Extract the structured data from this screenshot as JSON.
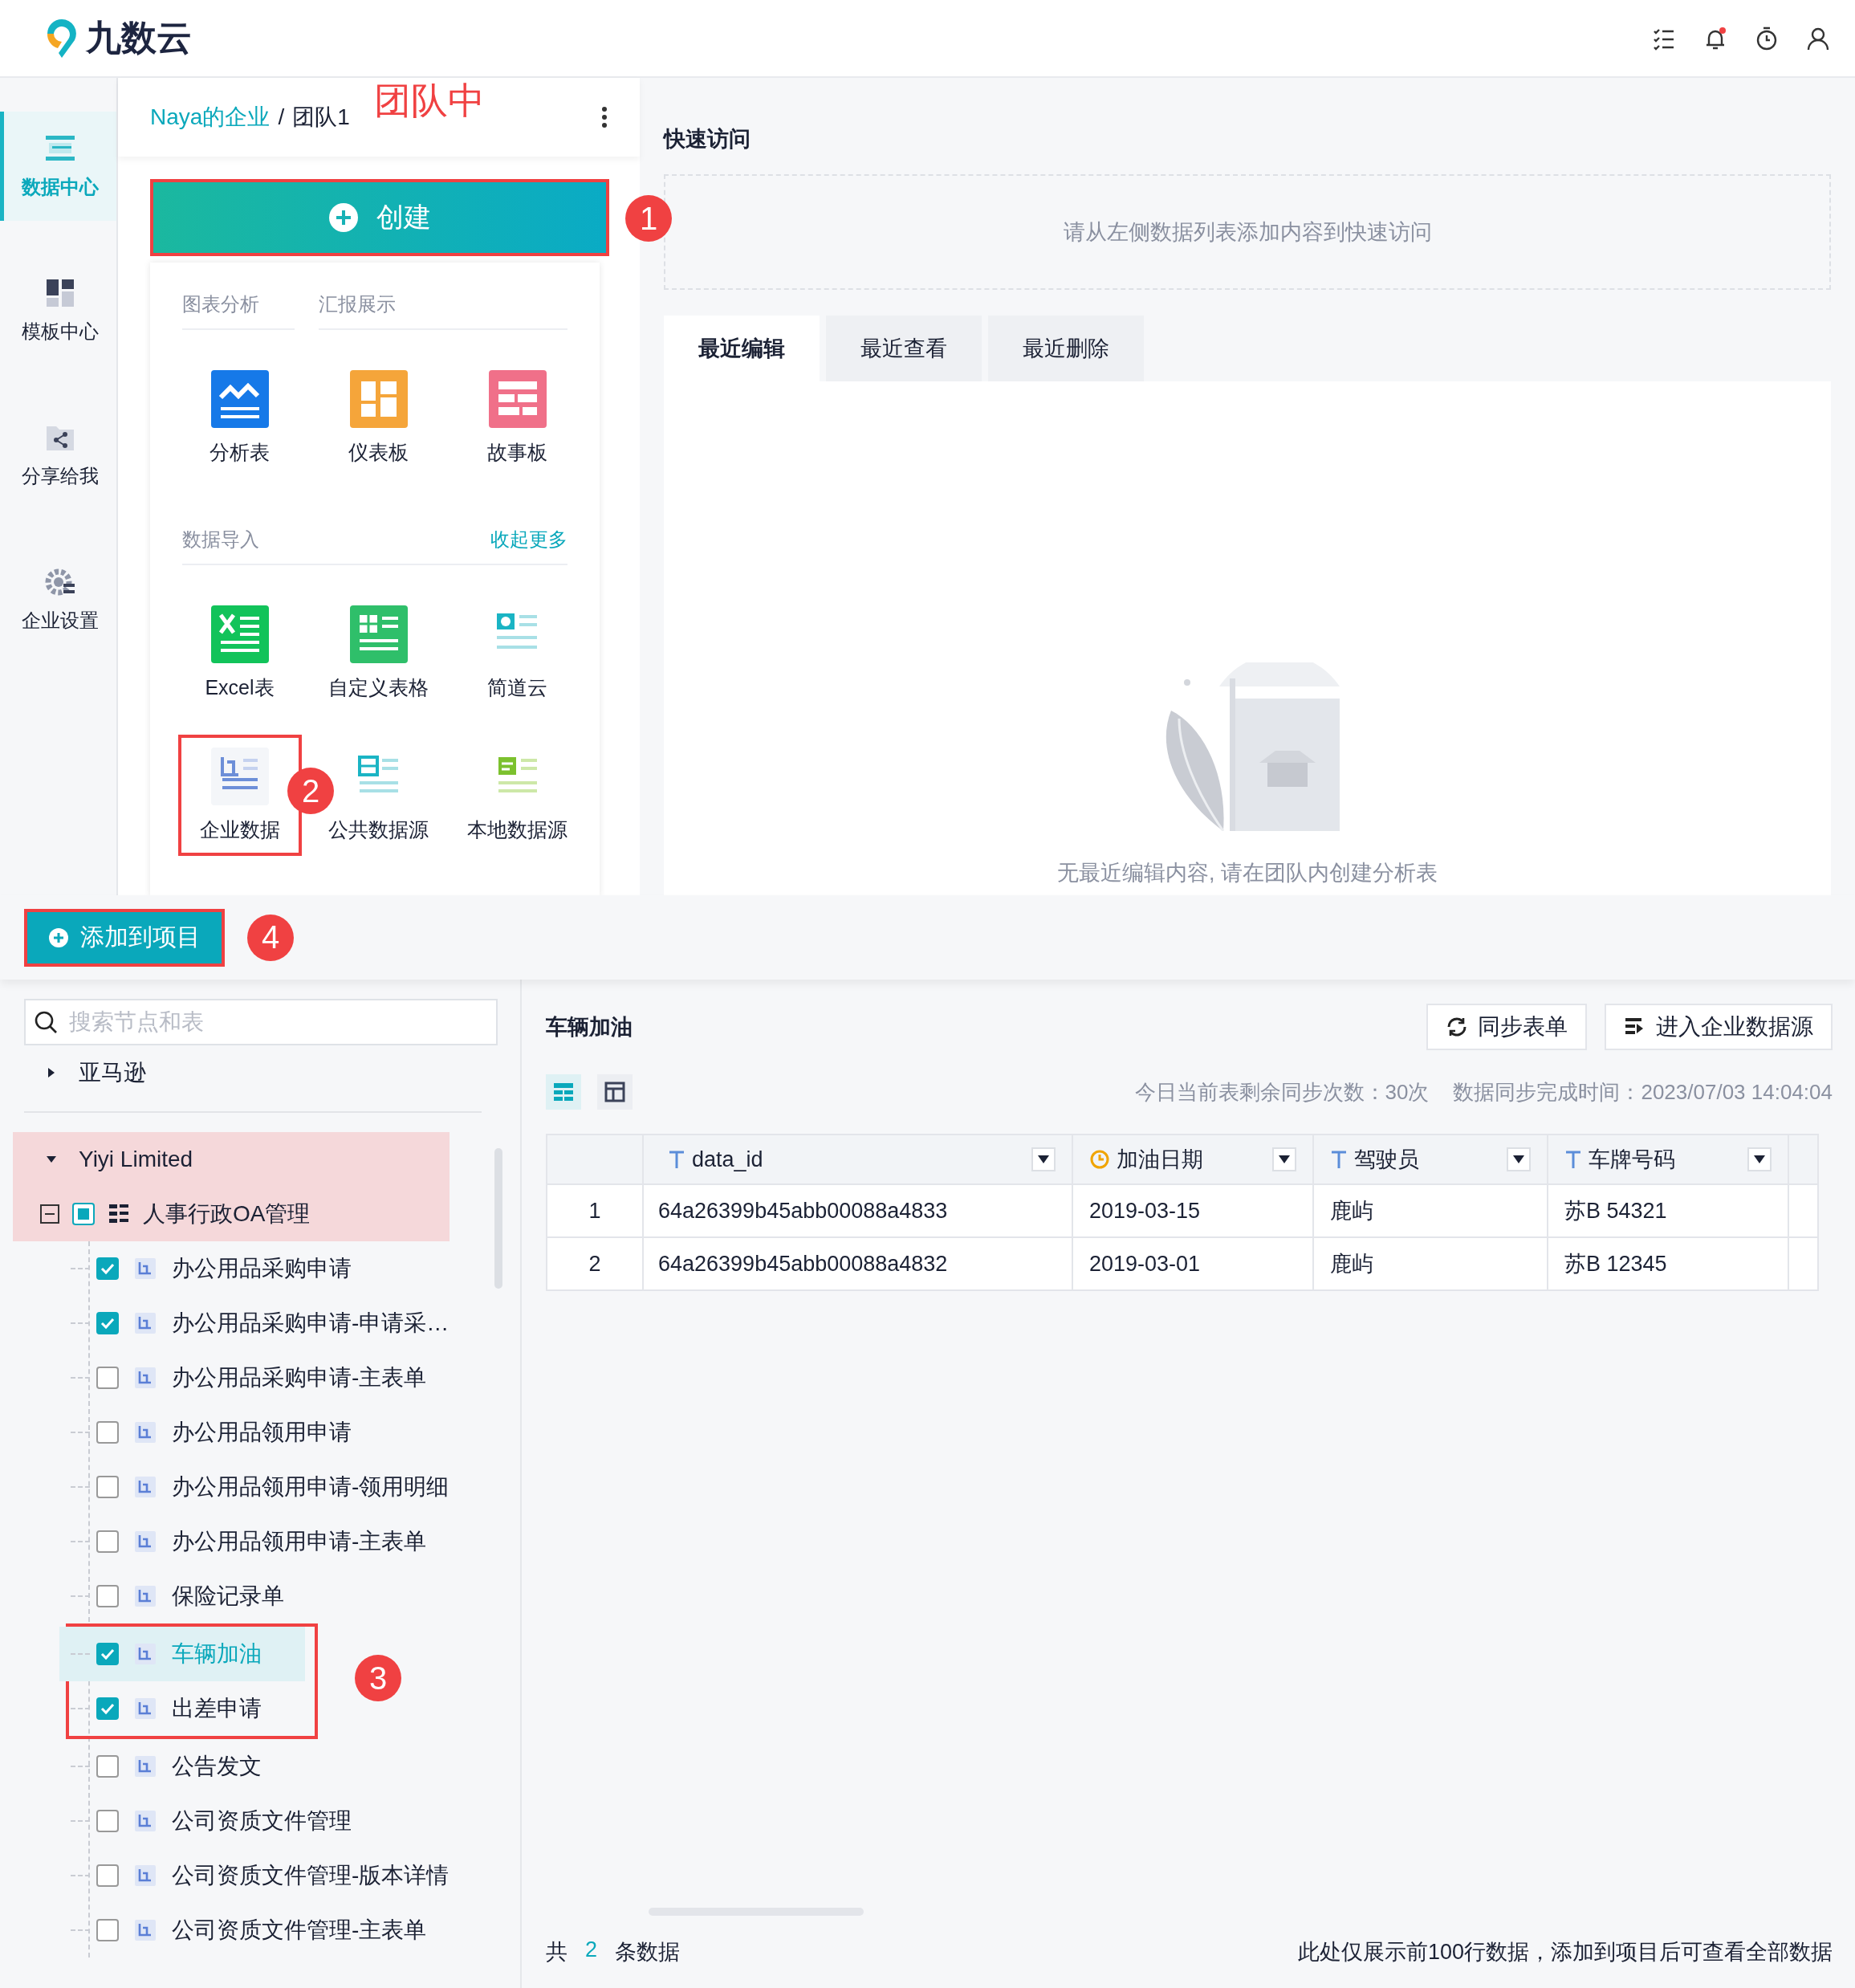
{
  "header": {
    "logo": "九数云",
    "notification_dot": true
  },
  "sidebar": {
    "items": [
      {
        "label": "数据中心",
        "kind": "data",
        "selected": true
      },
      {
        "label": "模板中心",
        "kind": "template",
        "selected": false
      },
      {
        "label": "分享给我",
        "kind": "share",
        "selected": false
      },
      {
        "label": "企业设置",
        "kind": "settings",
        "selected": false
      }
    ]
  },
  "team_panel": {
    "breadcrumb": {
      "link": "Naya的企业",
      "separator": "/",
      "current": "团队1"
    },
    "annotation": "团队中",
    "create_button": {
      "label": "创建",
      "callout": "1"
    },
    "menu": {
      "chart_tabs": [
        "图表分析",
        "汇报展示"
      ],
      "chart_items": [
        {
          "label": "分析表",
          "kind": "analysis"
        },
        {
          "label": "仪表板",
          "kind": "dashboard"
        },
        {
          "label": "故事板",
          "kind": "story"
        }
      ],
      "import_title": "数据导入",
      "import_action": "收起更多",
      "import_items": [
        {
          "label": "Excel表",
          "kind": "excel"
        },
        {
          "label": "自定义表格",
          "kind": "custom"
        },
        {
          "label": "简道云",
          "kind": "cloud"
        },
        {
          "label": "企业数据",
          "kind": "enterprise",
          "callout": "2"
        },
        {
          "label": "公共数据源",
          "kind": "public"
        },
        {
          "label": "本地数据源",
          "kind": "local"
        }
      ]
    }
  },
  "quick_access": {
    "title": "快速访问",
    "empty_text": "请从左侧数据列表添加内容到快速访问"
  },
  "recent_tabs": [
    {
      "label": "最近编辑",
      "selected": true
    },
    {
      "label": "最近查看",
      "selected": false
    },
    {
      "label": "最近删除",
      "selected": false
    }
  ],
  "recent_empty": "无最近编辑内容, 请在团队内创建分析表",
  "add_bar": {
    "label": "添加到项目",
    "callout": "4"
  },
  "tree": {
    "search_placeholder": "搜索节点和表",
    "callout_marker": "3",
    "nodes": [
      {
        "label": "亚马逊",
        "expanded": false,
        "highlighted": false
      },
      {
        "label": "Yiyi Limited",
        "expanded": true,
        "highlighted": true,
        "children": [
          {
            "label": "人事行政OA管理",
            "expanded": true,
            "checked": false,
            "indeterminate": true,
            "highlighted": true,
            "children": [
              {
                "label": "办公用品采购申请",
                "checked": true,
                "selected": false,
                "callout": false
              },
              {
                "label": "办公用品采购申请-申请采…",
                "checked": true,
                "selected": false,
                "callout": false
              },
              {
                "label": "办公用品采购申请-主表单",
                "checked": false,
                "selected": false,
                "callout": false
              },
              {
                "label": "办公用品领用申请",
                "checked": false,
                "selected": false,
                "callout": false
              },
              {
                "label": "办公用品领用申请-领用明细",
                "checked": false,
                "selected": false,
                "callout": false
              },
              {
                "label": "办公用品领用申请-主表单",
                "checked": false,
                "selected": false,
                "callout": false
              },
              {
                "label": "保险记录单",
                "checked": false,
                "selected": false,
                "callout": false
              },
              {
                "label": "车辆加油",
                "checked": true,
                "selected": true,
                "callout": true
              },
              {
                "label": "出差申请",
                "checked": true,
                "selected": false,
                "callout": true
              },
              {
                "label": "公告发文",
                "checked": false,
                "selected": false,
                "callout": false
              },
              {
                "label": "公司资质文件管理",
                "checked": false,
                "selected": false,
                "callout": false
              },
              {
                "label": "公司资质文件管理-版本详情",
                "checked": false,
                "selected": false,
                "callout": false
              },
              {
                "label": "公司资质文件管理-主表单",
                "checked": false,
                "selected": false,
                "callout": false
              }
            ]
          }
        ]
      }
    ]
  },
  "detail": {
    "title": "车辆加油",
    "buttons": [
      {
        "label": "同步表单",
        "kind": "sync"
      },
      {
        "label": "进入企业数据源",
        "kind": "enter"
      }
    ],
    "view_toggles": [
      {
        "kind": "rows",
        "selected": true
      },
      {
        "kind": "grid",
        "selected": false
      }
    ],
    "sync_count": "今日当前表剩余同步次数：30次",
    "sync_time": "数据同步完成时间：2023/07/03 14:04:04",
    "columns": [
      {
        "label": "data_id",
        "kind": "text"
      },
      {
        "label": "加油日期",
        "kind": "date"
      },
      {
        "label": "驾驶员",
        "kind": "text"
      },
      {
        "label": "车牌号码",
        "kind": "text"
      }
    ],
    "rows": [
      {
        "index": "1",
        "cells": [
          "64a26399b45abb00088a4833",
          "2019-03-15",
          "鹿屿",
          "苏B 54321"
        ]
      },
      {
        "index": "2",
        "cells": [
          "64a26399b45abb00088a4832",
          "2019-03-01",
          "鹿屿",
          "苏B 12345"
        ]
      }
    ],
    "footer": {
      "total_prefix": "共",
      "total": "2",
      "total_suffix": "条数据",
      "note": "此处仅展示前100行数据，添加到项目后可查看全部数据"
    }
  }
}
